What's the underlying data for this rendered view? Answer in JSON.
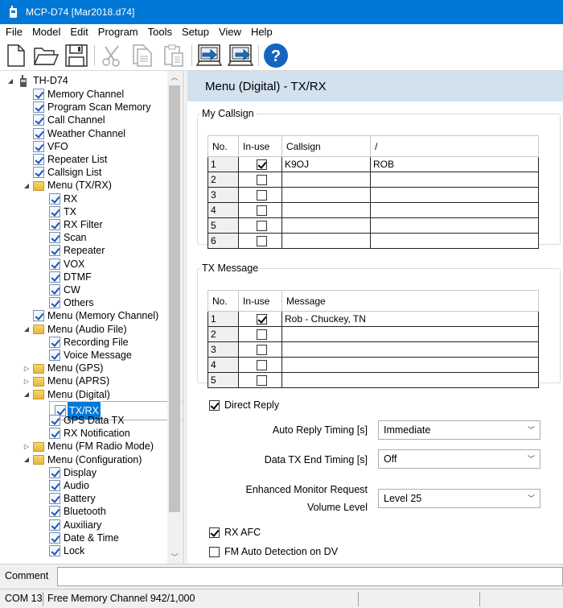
{
  "window": {
    "title": "MCP-D74 [Mar2018.d74]"
  },
  "menubar": [
    "File",
    "Model",
    "Edit",
    "Program",
    "Tools",
    "Setup",
    "View",
    "Help"
  ],
  "toolbar": {
    "buttons": [
      "new-file",
      "open-folder",
      "save",
      "cut",
      "copy",
      "paste",
      "read-from-radio",
      "write-to-radio",
      "help"
    ]
  },
  "tree": {
    "root": "TH-D74",
    "nodes": [
      {
        "label": "Memory Channel",
        "type": "check",
        "level": 1
      },
      {
        "label": "Program Scan Memory",
        "type": "check",
        "level": 1
      },
      {
        "label": "Call Channel",
        "type": "check",
        "level": 1
      },
      {
        "label": "Weather Channel",
        "type": "check",
        "level": 1
      },
      {
        "label": "VFO",
        "type": "check",
        "level": 1
      },
      {
        "label": "Repeater List",
        "type": "check",
        "level": 1
      },
      {
        "label": "Callsign List",
        "type": "check",
        "level": 1
      },
      {
        "label": "Menu (TX/RX)",
        "type": "folder",
        "level": 1,
        "expanded": true
      },
      {
        "label": "RX",
        "type": "check",
        "level": 2
      },
      {
        "label": "TX",
        "type": "check",
        "level": 2
      },
      {
        "label": "RX Filter",
        "type": "check",
        "level": 2
      },
      {
        "label": "Scan",
        "type": "check",
        "level": 2
      },
      {
        "label": "Repeater",
        "type": "check",
        "level": 2
      },
      {
        "label": "VOX",
        "type": "check",
        "level": 2
      },
      {
        "label": "DTMF",
        "type": "check",
        "level": 2
      },
      {
        "label": "CW",
        "type": "check",
        "level": 2
      },
      {
        "label": "Others",
        "type": "check",
        "level": 2
      },
      {
        "label": "Menu (Memory Channel)",
        "type": "check",
        "level": 1
      },
      {
        "label": "Menu (Audio File)",
        "type": "folder",
        "level": 1,
        "expanded": true
      },
      {
        "label": "Recording File",
        "type": "check",
        "level": 2
      },
      {
        "label": "Voice Message",
        "type": "check",
        "level": 2
      },
      {
        "label": "Menu (GPS)",
        "type": "folder",
        "level": 1,
        "expanded": false
      },
      {
        "label": "Menu (APRS)",
        "type": "folder",
        "level": 1,
        "expanded": false
      },
      {
        "label": "Menu (Digital)",
        "type": "folder",
        "level": 1,
        "expanded": true
      },
      {
        "label": "TX/RX",
        "type": "check",
        "level": 2,
        "selected": true
      },
      {
        "label": "GPS Data TX",
        "type": "check",
        "level": 2
      },
      {
        "label": "RX Notification",
        "type": "check",
        "level": 2
      },
      {
        "label": "Menu (FM Radio Mode)",
        "type": "folder",
        "level": 1,
        "expanded": false
      },
      {
        "label": "Menu (Configuration)",
        "type": "folder",
        "level": 1,
        "expanded": true
      },
      {
        "label": "Display",
        "type": "check",
        "level": 2
      },
      {
        "label": "Audio",
        "type": "check",
        "level": 2
      },
      {
        "label": "Battery",
        "type": "check",
        "level": 2
      },
      {
        "label": "Bluetooth",
        "type": "check",
        "level": 2
      },
      {
        "label": "Auxiliary",
        "type": "check",
        "level": 2
      },
      {
        "label": "Date & Time",
        "type": "check",
        "level": 2
      },
      {
        "label": "Lock",
        "type": "check",
        "level": 2
      }
    ]
  },
  "content": {
    "header": "Menu (Digital) - TX/RX",
    "my_callsign": {
      "legend": "My Callsign",
      "columns": [
        "No.",
        "In-use",
        "Callsign",
        "/"
      ],
      "rows": [
        {
          "no": "1",
          "inuse": true,
          "callsign": "K9OJ",
          "suffix": "ROB"
        },
        {
          "no": "2",
          "inuse": false,
          "callsign": "",
          "suffix": ""
        },
        {
          "no": "3",
          "inuse": false,
          "callsign": "",
          "suffix": ""
        },
        {
          "no": "4",
          "inuse": false,
          "callsign": "",
          "suffix": ""
        },
        {
          "no": "5",
          "inuse": false,
          "callsign": "",
          "suffix": ""
        },
        {
          "no": "6",
          "inuse": false,
          "callsign": "",
          "suffix": ""
        }
      ]
    },
    "tx_message": {
      "legend": "TX Message",
      "columns": [
        "No.",
        "In-use",
        "Message"
      ],
      "rows": [
        {
          "no": "1",
          "inuse": true,
          "message": "Rob - Chuckey, TN"
        },
        {
          "no": "2",
          "inuse": false,
          "message": ""
        },
        {
          "no": "3",
          "inuse": false,
          "message": ""
        },
        {
          "no": "4",
          "inuse": false,
          "message": ""
        },
        {
          "no": "5",
          "inuse": false,
          "message": ""
        }
      ]
    },
    "direct_reply": {
      "label": "Direct Reply",
      "checked": true
    },
    "auto_reply_timing": {
      "label": "Auto Reply Timing [s]",
      "value": "Immediate"
    },
    "data_tx_end_timing": {
      "label": "Data TX End Timing [s]",
      "value": "Off"
    },
    "enhanced_monitor": {
      "label_line1": "Enhanced Monitor Request",
      "label_line2": "Volume Level",
      "value": "Level 25"
    },
    "rx_afc": {
      "label": "RX AFC",
      "checked": true
    },
    "fm_auto_detection": {
      "label": "FM Auto Detection on DV",
      "checked": false
    }
  },
  "comment": {
    "label": "Comment",
    "value": ""
  },
  "status": {
    "port": "COM 13",
    "memory": "Free Memory Channel 942/1,000"
  }
}
